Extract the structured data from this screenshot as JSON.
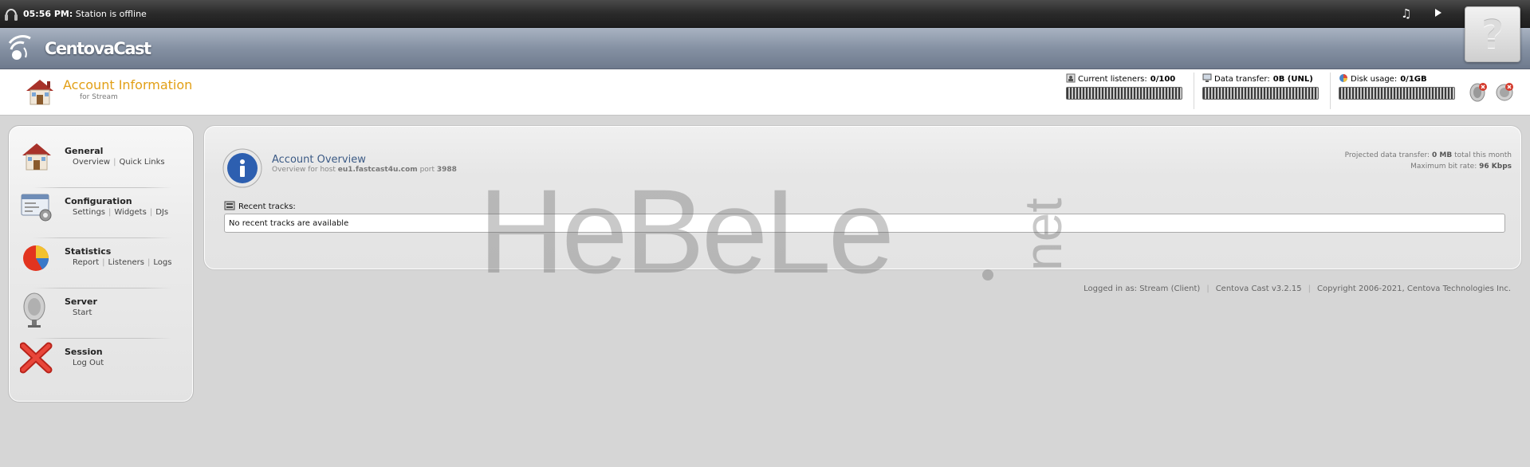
{
  "statusbar": {
    "time": "05:56 PM:",
    "status": "Station is offline",
    "help_label": "?"
  },
  "brand": {
    "logo_text": "CentovaCast"
  },
  "header": {
    "title": "Account Information",
    "subtitle": "for Stream",
    "meters": [
      {
        "label": "Current listeners:",
        "value": "0/100",
        "icon": "users-icon"
      },
      {
        "label": "Data transfer:",
        "value": "0B (UNL)",
        "icon": "computer-icon"
      },
      {
        "label": "Disk usage:",
        "value": "0/1GB",
        "icon": "disk-icon"
      }
    ]
  },
  "sidebar": {
    "sections": [
      {
        "title": "General",
        "links": [
          "Overview",
          "Quick Links"
        ],
        "icon": "house-icon"
      },
      {
        "title": "Configuration",
        "links": [
          "Settings",
          "Widgets",
          "DJs"
        ],
        "icon": "settings-window-icon"
      },
      {
        "title": "Statistics",
        "links": [
          "Report",
          "Listeners",
          "Logs"
        ],
        "icon": "pie-chart-icon"
      },
      {
        "title": "Server",
        "links": [
          "Start"
        ],
        "icon": "satellite-dish-icon"
      },
      {
        "title": "Session",
        "links": [
          "Log Out"
        ],
        "icon": "red-x-icon"
      }
    ]
  },
  "main": {
    "title": "Account Overview",
    "subtitle_prefix": "Overview for host",
    "host": "eu1.fastcast4u.com",
    "port_label": "port",
    "port": "3988",
    "projected_label": "Projected data transfer:",
    "projected_value": "0 MB",
    "projected_suffix": "total this month",
    "bitrate_label": "Maximum bit rate:",
    "bitrate_value": "96 Kbps",
    "recent_tracks_label": "Recent tracks:",
    "recent_tracks_text": "No recent tracks are available"
  },
  "watermark": {
    "text": "HeBeLe",
    "suffix": "net"
  },
  "footer": {
    "logged_in": "Logged in as: Stream (Client)",
    "version": "Centova Cast v3.2.15",
    "copyright": "Copyright 2006-2021, Centova Technologies Inc."
  }
}
